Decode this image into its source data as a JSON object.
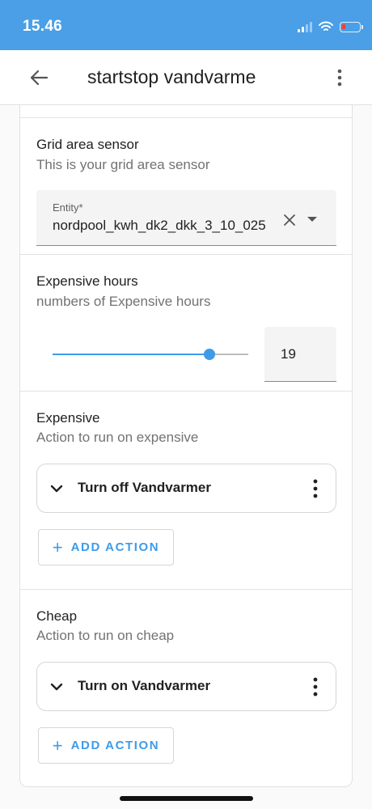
{
  "status_bar": {
    "time": "15.46",
    "icons": [
      "signal-icon",
      "wifi-icon",
      "battery-low-icon"
    ]
  },
  "app_bar": {
    "title": "startstop vandvarme",
    "back_icon": "arrow-left-icon",
    "menu_icon": "more-vert-icon"
  },
  "grid_area": {
    "title": "Grid area sensor",
    "description": "This is your grid area sensor",
    "entity_label": "Entity*",
    "entity_value": "nordpool_kwh_dk2_dkk_3_10_025"
  },
  "expensive_hours": {
    "title": "Expensive hours",
    "description": "numbers of Expensive hours",
    "slider_value": 19,
    "slider_fraction": 0.8,
    "value_text": "19"
  },
  "expensive": {
    "title": "Expensive",
    "description": "Action to run on expensive",
    "actions": [
      {
        "label": "Turn off Vandvarmer"
      }
    ],
    "add_action_label": "ADD ACTION",
    "add_action_icon": "+"
  },
  "cheap": {
    "title": "Cheap",
    "description": "Action to run on cheap",
    "actions": [
      {
        "label": "Turn on Vandvarmer"
      }
    ],
    "add_action_label": "ADD ACTION",
    "add_action_icon": "+"
  },
  "colors": {
    "accent": "#3d9be9",
    "status_bar": "#4a9fe6",
    "text": "#212121",
    "secondary_text": "#727272"
  }
}
